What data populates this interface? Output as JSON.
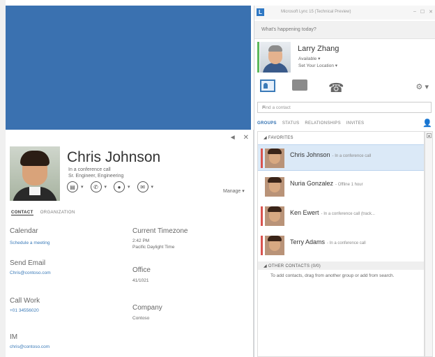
{
  "contact_card": {
    "name": "Chris Johnson",
    "status": "In a conference call",
    "title": "Sr. Engineer, Engineering",
    "manage_label": "Manage ▾",
    "actions": [
      {
        "icon": "chat-icon",
        "glyph": "▤"
      },
      {
        "icon": "phone-icon",
        "glyph": "✆"
      },
      {
        "icon": "video-icon",
        "glyph": "●"
      },
      {
        "icon": "email-icon",
        "glyph": "✉"
      }
    ],
    "tabs": [
      "CONTACT",
      "ORGANIZATION"
    ],
    "fields": {
      "calendar_label": "Calendar",
      "calendar_value": "Schedule a meeting",
      "timezone_label": "Current Timezone",
      "timezone_time": "2:42 PM",
      "timezone_name": "Pacific Daylight Time",
      "email_label": "Send Email",
      "email_value": "Chris@contoso.com",
      "office_label": "Office",
      "office_value": "41/1021",
      "callwork_label": "Call Work",
      "callwork_value": "+01 34556020",
      "company_label": "Company",
      "company_value": "Contoso",
      "im_label": "IM",
      "im_value": "chris@contoso.com"
    }
  },
  "lync": {
    "title": "Microsoft Lync 15 (Technical Preview)",
    "window_controls": [
      "–",
      "☐",
      "✕"
    ],
    "whats_happening": "What's happening today?",
    "me": {
      "name": "Larry Zhang",
      "status": "Available ▾",
      "location": "Set Your Location ▾"
    },
    "find_placeholder": "Find a contact",
    "tabs": [
      "GROUPS",
      "STATUS",
      "RELATIONSHIPS",
      "INVITES"
    ],
    "favorites_header": "◢ FAVORITES",
    "contacts": [
      {
        "name": "Chris Johnson",
        "status": "- In a conference call",
        "presence": "#d9534f"
      },
      {
        "name": "Nuria Gonzalez",
        "status": "- Offline 1 hour",
        "presence": "#ffffff"
      },
      {
        "name": "Ken Ewert",
        "status": "- In a conference call (track...",
        "presence": "#d9534f"
      },
      {
        "name": "Terry Adams",
        "status": "- In a conference call",
        "presence": "#d9534f"
      }
    ],
    "other_header": "◢ OTHER CONTACTS (0/0)",
    "other_note": "To add contacts, drag from another group or add from search."
  }
}
